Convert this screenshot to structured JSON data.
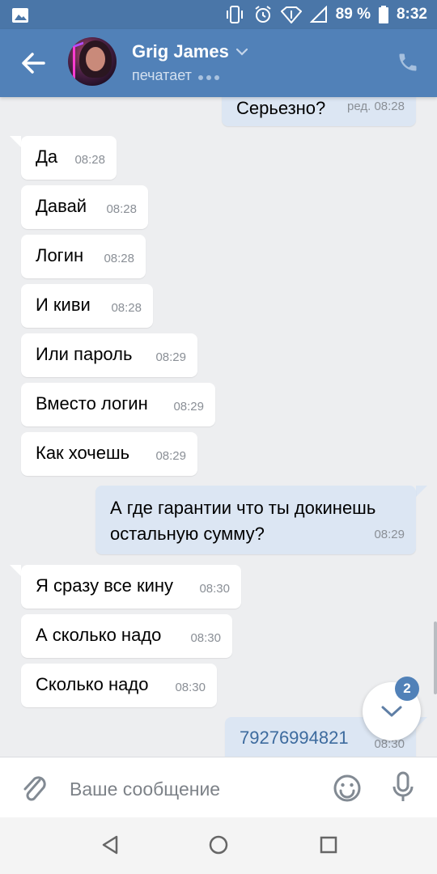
{
  "status_bar": {
    "battery": "89 %",
    "time": "8:32"
  },
  "header": {
    "contact_name": "Grig James",
    "status": "печатает"
  },
  "messages": [
    {
      "dir": "out",
      "text": "Серьезно?",
      "time": "ред. 08:28"
    },
    {
      "dir": "in",
      "text": "Да",
      "time": "08:28"
    },
    {
      "dir": "in",
      "text": "Давай",
      "time": "08:28"
    },
    {
      "dir": "in",
      "text": "Логин",
      "time": "08:28"
    },
    {
      "dir": "in",
      "text": "И киви",
      "time": "08:28"
    },
    {
      "dir": "in",
      "text": "Или пароль",
      "time": "08:29"
    },
    {
      "dir": "in",
      "text": "Вместо логин",
      "time": "08:29"
    },
    {
      "dir": "in",
      "text": "Как хочешь",
      "time": "08:29"
    },
    {
      "dir": "out",
      "text": "А где гарантии что ты докинешь\nостальную сумму?",
      "time": "08:29"
    },
    {
      "dir": "in",
      "text": "Я сразу все кину",
      "time": "08:30"
    },
    {
      "dir": "in",
      "text": "А сколько надо",
      "time": "08:30"
    },
    {
      "dir": "in",
      "text": "Сколько надо",
      "time": "08:30"
    },
    {
      "dir": "out",
      "text": "79276994821",
      "time": "08:30"
    }
  ],
  "scroll_button": {
    "unread_count": "2"
  },
  "composer": {
    "placeholder": "Ваше сообщение"
  }
}
